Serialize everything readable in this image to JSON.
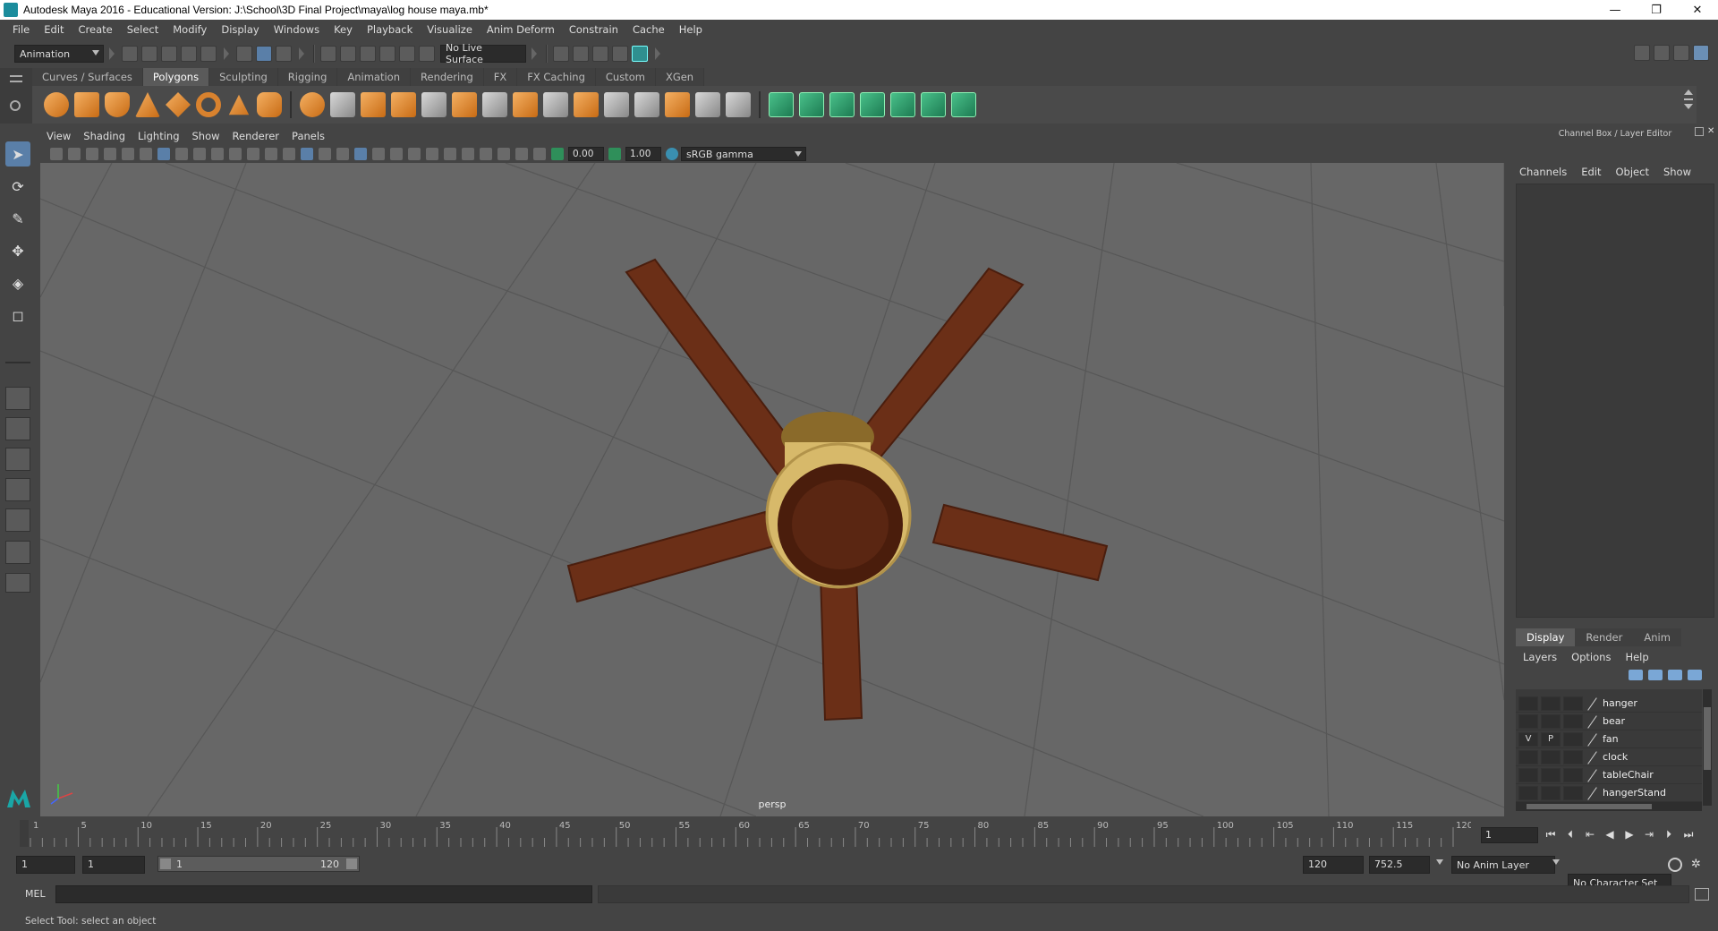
{
  "window": {
    "title": "Autodesk Maya 2016 - Educational Version: J:\\School\\3D Final Project\\maya\\log house maya.mb*",
    "minimize": "—",
    "maximize": "❐",
    "close": "✕"
  },
  "menus": [
    "File",
    "Edit",
    "Create",
    "Select",
    "Modify",
    "Display",
    "Windows",
    "Key",
    "Playback",
    "Visualize",
    "Anim Deform",
    "Constrain",
    "Cache",
    "Help"
  ],
  "status": {
    "mode": "Animation",
    "live_surface": "No Live Surface"
  },
  "shelf": {
    "tabs": [
      "Curves / Surfaces",
      "Polygons",
      "Sculpting",
      "Rigging",
      "Animation",
      "Rendering",
      "FX",
      "FX Caching",
      "Custom",
      "XGen"
    ],
    "active_tab": "Polygons"
  },
  "viewport": {
    "panel_menus": [
      "View",
      "Shading",
      "Lighting",
      "Show",
      "Renderer",
      "Panels"
    ],
    "exposure": "0.00",
    "gamma": "1.00",
    "color_space": "sRGB gamma",
    "camera": "persp"
  },
  "channel_box": {
    "title": "Channel Box / Layer Editor",
    "menus": [
      "Channels",
      "Edit",
      "Object",
      "Show"
    ]
  },
  "layer_editor": {
    "tabs": [
      "Display",
      "Render",
      "Anim"
    ],
    "active_tab": "Display",
    "menus": [
      "Layers",
      "Options",
      "Help"
    ],
    "layers": [
      {
        "v": "",
        "p": "",
        "name": "hanger"
      },
      {
        "v": "",
        "p": "",
        "name": "bear"
      },
      {
        "v": "V",
        "p": "P",
        "name": "fan"
      },
      {
        "v": "",
        "p": "",
        "name": "clock"
      },
      {
        "v": "",
        "p": "",
        "name": "tableChair"
      },
      {
        "v": "",
        "p": "",
        "name": "hangerStand"
      }
    ]
  },
  "timeline": {
    "ticks": [
      "1",
      "5",
      "10",
      "15",
      "20",
      "25",
      "30",
      "35",
      "40",
      "45",
      "50",
      "55",
      "60",
      "65",
      "70",
      "75",
      "80",
      "85",
      "90",
      "95",
      "100",
      "105",
      "110",
      "115",
      "120"
    ],
    "current_frame": "1"
  },
  "range": {
    "start": "1",
    "playback_start": "1",
    "slider_start": "1",
    "slider_end": "120",
    "playback_end": "120",
    "end": "752.5",
    "anim_layer": "No Anim Layer",
    "character_set": "No Character Set"
  },
  "command_line": {
    "label": "MEL"
  },
  "help_line": "Select Tool: select an object",
  "colors": {
    "wood": "#6b2f17",
    "wood_light": "#8a4425",
    "brass": "#d7b96a",
    "grid_bg": "#676767",
    "accent_green": "#3ecf7a"
  }
}
